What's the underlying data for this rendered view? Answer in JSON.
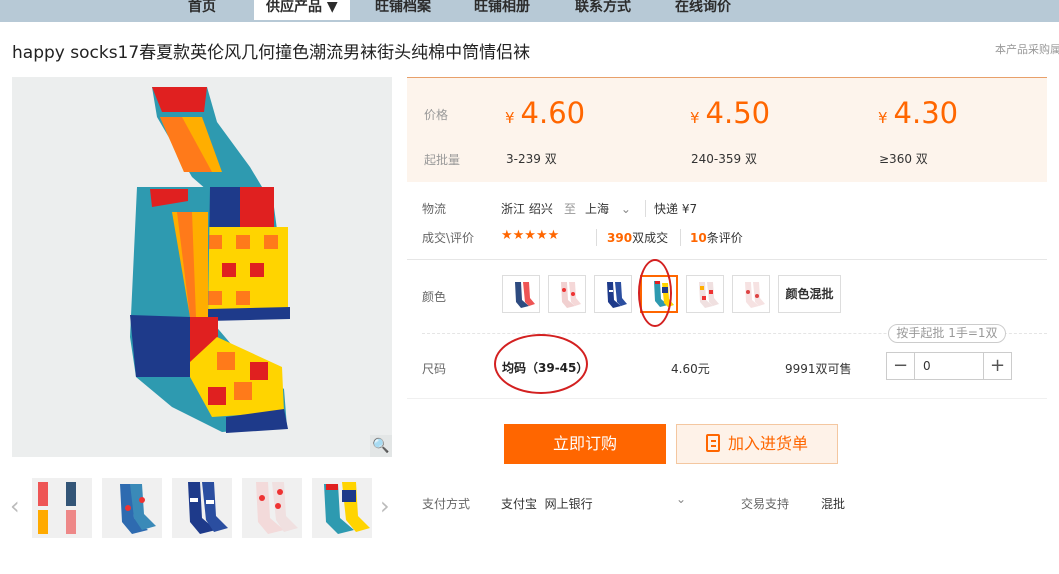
{
  "nav": {
    "items": [
      "首页",
      "供应产品 ▼",
      "旺铺档案",
      "旺铺相册",
      "联系方式",
      "在线询价"
    ]
  },
  "product": {
    "title": "happy socks17春夏款英伦风几何撞色潮流男袜街头纯棉中筒情侣袜",
    "note": "本产品采购属于商业行为"
  },
  "pricing": {
    "price_label": "价格",
    "qty_label": "起批量",
    "currency": "¥",
    "tiers": [
      {
        "price": "4.60",
        "qty": "3-239",
        "unit": "双"
      },
      {
        "price": "4.50",
        "qty": "240-359",
        "unit": "双"
      },
      {
        "price": "4.30",
        "qty": "≥360",
        "unit": "双"
      }
    ]
  },
  "logistics": {
    "label": "物流",
    "from": "浙江 绍兴",
    "to_word": "至",
    "to": "上海",
    "express": "快递 ¥7"
  },
  "deals": {
    "label": "成交\\评价",
    "stars": "★★★★★",
    "sold_count": "390",
    "sold_suffix": "双成交",
    "review_count": "10",
    "review_suffix": "条评价"
  },
  "color": {
    "label": "颜色",
    "mixed_label": "颜色混批"
  },
  "size": {
    "label": "尺码",
    "value": "均码（39-45）",
    "price": "4.60元",
    "stock": "9991双可售",
    "tip": "按手起批 1手=1双",
    "quantity": "0"
  },
  "actions": {
    "order": "立即订购",
    "cart": "加入进货单"
  },
  "payment": {
    "label": "支付方式",
    "methods": "支付宝  网上银行",
    "trade_label": "交易支持",
    "trade_value": "混批"
  },
  "colors": {
    "accent": "#ff6600",
    "nav_bg": "#b7c9d6",
    "annotation": "#d32020"
  }
}
